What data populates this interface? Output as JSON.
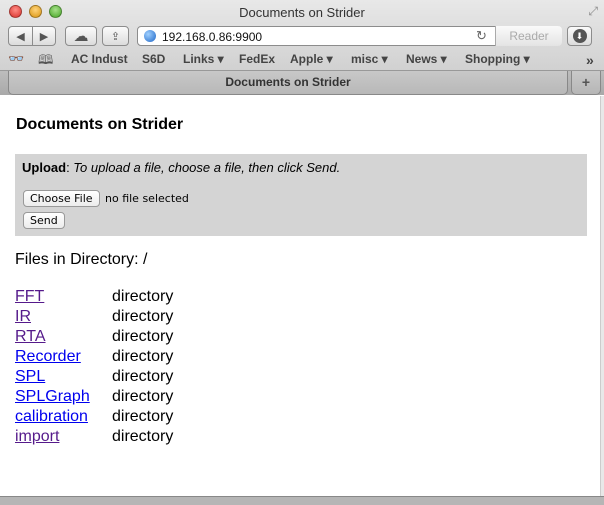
{
  "window": {
    "title": "Documents on Strider"
  },
  "toolbar": {
    "back_icon": "◀",
    "forward_icon": "▶",
    "icloud_icon": "☁",
    "share_icon": "⇪",
    "url": "192.168.0.86:9900",
    "reload_icon": "↻",
    "reader_label": "Reader",
    "download_icon": "⬇"
  },
  "bookmarks": {
    "reading_list_icon": "👓",
    "bookmarks_icon": "📖",
    "items": [
      {
        "label": "AC Indust",
        "has_menu": false
      },
      {
        "label": "S6D",
        "has_menu": false
      },
      {
        "label": "Links ▾",
        "has_menu": true
      },
      {
        "label": "FedEx",
        "has_menu": false
      },
      {
        "label": "Apple ▾",
        "has_menu": true
      },
      {
        "label": "misc ▾",
        "has_menu": true
      },
      {
        "label": "News ▾",
        "has_menu": true
      },
      {
        "label": "Shopping ▾",
        "has_menu": true
      }
    ],
    "overflow_icon": "»"
  },
  "tabs": {
    "active": "Documents on Strider",
    "new_tab_icon": "+"
  },
  "page": {
    "heading": "Documents on Strider",
    "upload": {
      "label": "Upload",
      "instructions": "To upload a file, choose a file, then click Send.",
      "choose_button": "Choose File",
      "file_status": "no file selected",
      "send_button": "Send"
    },
    "directory_heading": "Files in Directory: /",
    "files": [
      {
        "name": "FFT",
        "type": "directory",
        "visited": true
      },
      {
        "name": "IR",
        "type": "directory",
        "visited": true
      },
      {
        "name": "RTA",
        "type": "directory",
        "visited": true
      },
      {
        "name": "Recorder",
        "type": "directory",
        "visited": false
      },
      {
        "name": "SPL",
        "type": "directory",
        "visited": false
      },
      {
        "name": "SPLGraph",
        "type": "directory",
        "visited": false
      },
      {
        "name": "calibration",
        "type": "directory",
        "visited": false
      },
      {
        "name": "import",
        "type": "directory",
        "visited": true
      }
    ]
  },
  "colors": {
    "link": "#0000ee",
    "visited_link": "#551a8b",
    "upload_bg": "#d4d4d4"
  }
}
